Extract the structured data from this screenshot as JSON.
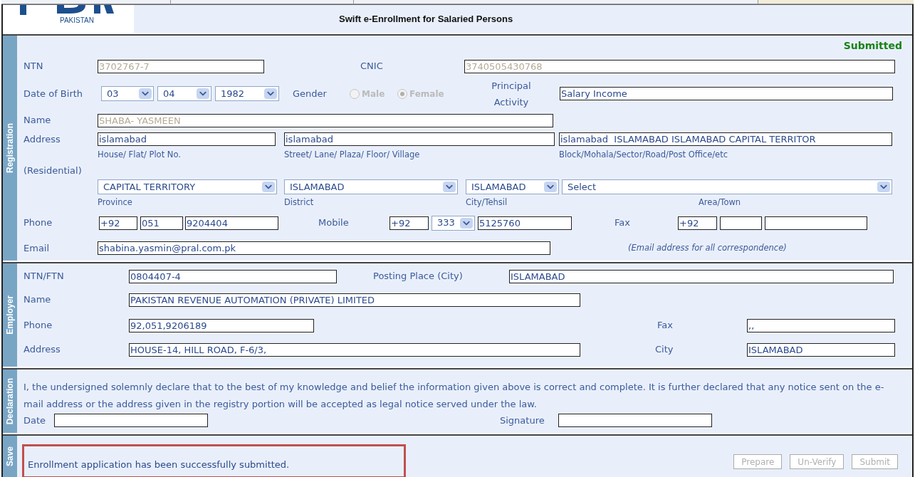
{
  "header": {
    "logo_caption": "PAKISTAN",
    "title": "Swift e-Enrollment for Salaried Persons"
  },
  "registration": {
    "section_label": "Registration",
    "status": "Submitted",
    "ntn": {
      "label": "NTN",
      "value": "3702767-7",
      "disabled": true
    },
    "cnic": {
      "label": "CNIC",
      "value": "3740505430768",
      "disabled": true
    },
    "dob": {
      "label": "Date of Birth",
      "day": "03",
      "month": "04",
      "year": "1982"
    },
    "gender": {
      "label": "Gender",
      "disabled": true,
      "options": [
        {
          "label": "Male",
          "selected": false
        },
        {
          "label": "Female",
          "selected": true
        }
      ]
    },
    "principal_activity": {
      "label": "Principal Activity",
      "value": "Salary Income"
    },
    "name": {
      "label": "Name",
      "value": "SHABA- YASMEEN",
      "disabled": true
    },
    "address": {
      "label": "Address",
      "label_2": "(Residential)",
      "fields": [
        {
          "value": "islamabad",
          "caption": "House/ Flat/ Plot No."
        },
        {
          "value": "islamabad",
          "caption": "Street/ Lane/ Plaza/ Floor/ Village"
        },
        {
          "value": "islamabad  ISLAMABAD ISLAMABAD CAPITAL TERRITOR",
          "caption": "Block/Mohala/Sector/Road/Post Office/etc"
        }
      ]
    },
    "location": [
      {
        "value": "CAPITAL TERRITORY",
        "caption": "Province"
      },
      {
        "value": "ISLAMABAD",
        "caption": "District"
      },
      {
        "value": "ISLAMABAD",
        "caption": "City/Tehsil"
      },
      {
        "value": "Select",
        "caption": "Area/Town"
      }
    ],
    "phone": {
      "label": "Phone",
      "country": "+92",
      "area": "051",
      "number": "9204404"
    },
    "mobile": {
      "label": "Mobile",
      "country": "+92",
      "network": "333",
      "number": "5125760"
    },
    "fax": {
      "label": "Fax",
      "country": "+92"
    },
    "email": {
      "label": "Email",
      "value": "shabina.yasmin@pral.com.pk",
      "note": "(Email address for all correspondence)"
    }
  },
  "employer": {
    "section_label": "Employer",
    "ntn": {
      "label": "NTN/FTN",
      "value": "0804407-4"
    },
    "posting_place": {
      "label": "Posting Place (City)",
      "value": "ISLAMABAD"
    },
    "name": {
      "label": "Name",
      "value": "PAKISTAN REVENUE AUTOMATION (PRIVATE) LIMITED"
    },
    "phone": {
      "label": "Phone",
      "value": "92,051,9206189"
    },
    "fax": {
      "label": "Fax",
      "value": ",,"
    },
    "address": {
      "label": "Address",
      "value": "HOUSE-14, HILL ROAD, F-6/3,"
    },
    "city": {
      "label": "City",
      "value": "ISLAMABAD"
    }
  },
  "declaration": {
    "section_label": "Declaration",
    "text": "I, the undersigned solemnly declare that to the best of my knowledge and belief the information given above is correct and complete. It is further declared that any notice sent on the e-mail address or the address given in the registry portion will be accepted as legal notice served under the law.",
    "date_label": "Date",
    "signature_label": "Signature"
  },
  "save": {
    "section_label": "Save",
    "message": "Enrollment application has been successfully submitted.",
    "buttons": [
      {
        "label": "Prepare",
        "disabled": true
      },
      {
        "label": "Un-Verify",
        "disabled": true
      },
      {
        "label": "Submit",
        "disabled": true
      }
    ]
  }
}
